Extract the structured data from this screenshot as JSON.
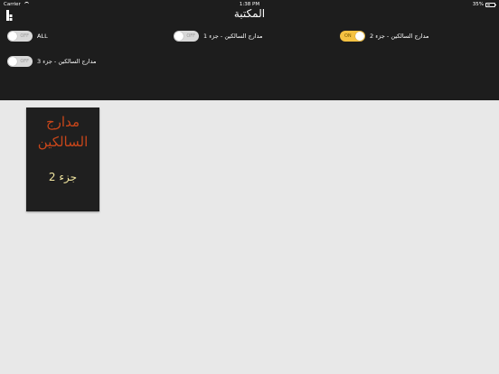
{
  "status_bar": {
    "carrier": "Carrier",
    "time": "1:38 PM",
    "battery": "35%"
  },
  "header": {
    "title": "المكتبة"
  },
  "toggles": [
    {
      "label": "ALL",
      "state": "OFF",
      "on": false
    },
    {
      "label": "مدارج السالكين - جزء 1",
      "state": "OFF",
      "on": false
    },
    {
      "label": "مدارج السالكين - جزء 2",
      "state": "ON",
      "on": true
    },
    {
      "label": "مدارج السالكين - جزء 3",
      "state": "OFF",
      "on": false
    }
  ],
  "book": {
    "title_line1": "مدارج",
    "title_line2": "السالكين",
    "part": "جزء 2"
  },
  "colors": {
    "header_bg": "#1d1d1d",
    "accent_on": "#f5c242",
    "book_title": "#c8461a",
    "book_part": "#f2e6a0"
  }
}
